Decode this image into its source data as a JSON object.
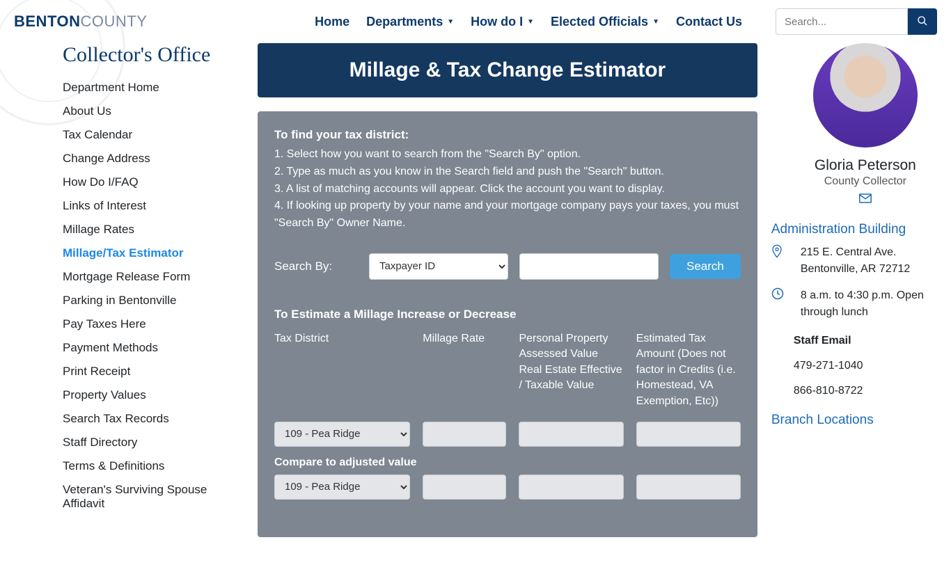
{
  "brand": {
    "part1": "BENTON",
    "part2": "COUNTY"
  },
  "nav": {
    "home": "Home",
    "departments": "Departments",
    "howdoi": "How do I",
    "elected": "Elected Officials",
    "contact": "Contact Us"
  },
  "search": {
    "placeholder": "Search..."
  },
  "sidebar": {
    "title": "Collector's Office",
    "items": [
      "Department Home",
      "About Us",
      "Tax Calendar",
      "Change Address",
      "How Do I/FAQ",
      "Links of Interest",
      "Millage Rates",
      "Millage/Tax Estimator",
      "Mortgage Release Form",
      "Parking in Bentonville",
      "Pay Taxes Here",
      "Payment Methods",
      "Print Receipt",
      "Property Values",
      "Search Tax Records",
      "Staff Directory",
      "Terms & Definitions",
      "Veteran's Surviving Spouse Affidavit"
    ],
    "active_index": 7
  },
  "page_title": "Millage & Tax Change Estimator",
  "intro": {
    "head": "To find your tax district:",
    "lines": [
      "1. Select how you want to search from the \"Search By\" option.",
      "2. Type as much as you know in the Search field and push the \"Search\" button.",
      "3. A list of matching accounts will appear. Click the account you want to display.",
      "4. If looking up property by your name and your mortgage company pays your taxes, you must \"Search By\" Owner Name."
    ]
  },
  "searchby": {
    "label": "Search By:",
    "selected": "Taxpayer ID",
    "button": "Search"
  },
  "estimator": {
    "head": "To Estimate a Millage Increase or Decrease",
    "columns": [
      "Tax District",
      "Millage Rate",
      "Personal Property Assessed Value Real Estate Effective / Taxable Value",
      "Estimated Tax Amount (Does not factor in Credits (i.e. Homestead, VA Exemption, Etc))"
    ],
    "district_selected": "109 - Pea Ridge",
    "compare_label": "Compare to adjusted value",
    "compare_district": "109 - Pea Ridge"
  },
  "official": {
    "name": "Gloria Peterson",
    "title": "County Collector"
  },
  "location": {
    "heading": "Administration Building",
    "address_lines": [
      "215 E. Central Ave.",
      "Bentonville, AR 72712"
    ],
    "hours": "8 a.m. to 4:30 p.m. Open through lunch",
    "staff_email": "Staff Email",
    "phones": [
      "479-271-1040",
      "866-810-8722"
    ]
  },
  "branch_heading": "Branch Locations"
}
